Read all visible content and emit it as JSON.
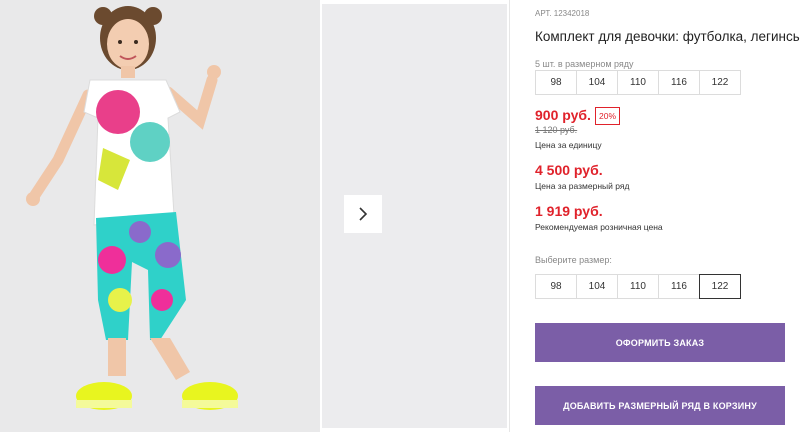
{
  "product": {
    "article": "АРТ. 12342018",
    "title": "Комплект для девочки: футболка, легинсы",
    "set_note": "5 шт. в размерном ряду",
    "set_sizes": [
      "98",
      "104",
      "110",
      "116",
      "122"
    ],
    "unit_price": "900 руб.",
    "discount": "20%",
    "old_price": "1 120 руб.",
    "unit_price_caption": "Цена за единицу",
    "set_price": "4 500 руб.",
    "set_price_caption": "Цена за размерный ряд",
    "retail_price": "1 919 руб.",
    "retail_price_caption": "Рекомендуемая розничная цена",
    "choose_size_label": "Выберите размер:",
    "choose_sizes": [
      "98",
      "104",
      "110",
      "116",
      "122"
    ],
    "selected_size": "122"
  },
  "actions": {
    "order_label": "ОФОРМИТЬ ЗАКАЗ",
    "add_set_label": "ДОБАВИТЬ РАЗМЕРНЫЙ РЯД В КОРЗИНУ"
  },
  "gallery": {
    "next_icon": "chevron-right-icon"
  },
  "colors": {
    "accent": "#7b5ea7",
    "price": "#e0222b"
  }
}
